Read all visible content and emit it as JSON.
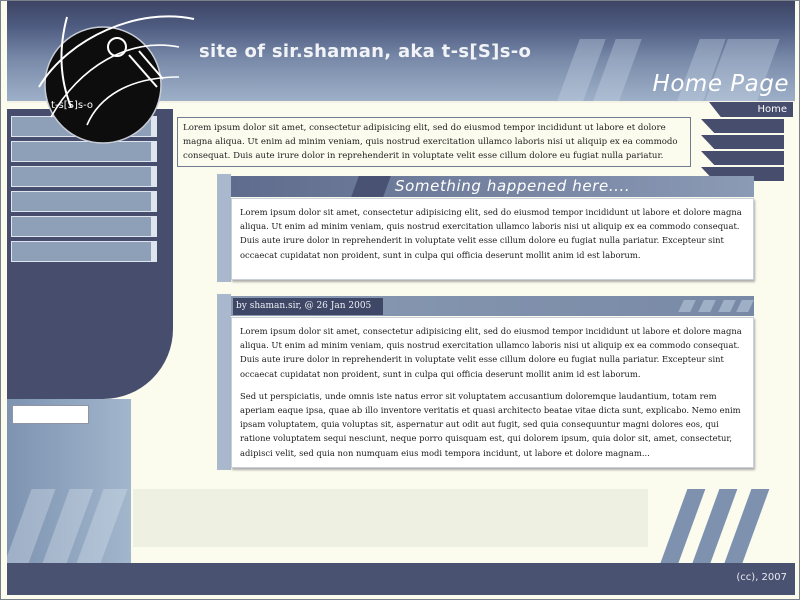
{
  "header": {
    "site_title": "site of sir.shaman, aka t-s[S]s-o",
    "page_heading": "Home Page",
    "logo_text": "t-s[S]s-o"
  },
  "nav": {
    "home_tab": "Home",
    "sidebar_buttons": [
      "",
      "",
      "",
      "",
      "",
      ""
    ],
    "side_tabs": [
      "",
      "",
      "",
      ""
    ]
  },
  "search": {
    "value": ""
  },
  "intro": {
    "text": "Lorem ipsum dolor sit amet, consectetur adipisicing elit, sed do eiusmod tempor incididunt ut labore et dolore magna aliqua. Ut enim ad minim veniam, quis nostrud exercitation ullamco laboris nisi ut aliquip ex ea commodo consequat. Duis aute irure dolor in reprehenderit in voluptate velit esse cillum dolore eu fugiat nulla pariatur."
  },
  "post1": {
    "title": "Something happened here....",
    "body": "Lorem ipsum dolor sit amet, consectetur adipisicing elit, sed do eiusmod tempor incididunt ut labore et dolore magna aliqua. Ut enim ad minim veniam, quis nostrud exercitation ullamco laboris nisi ut aliquip ex ea commodo consequat. Duis aute irure dolor in reprehenderit in voluptate velit esse cillum dolore eu fugiat nulla pariatur. Excepteur sint occaecat cupidatat non proident, sunt in culpa qui officia deserunt mollit anim id est laborum."
  },
  "post2": {
    "byline": "by shaman.sir, @ 26 Jan 2005",
    "paragraph1": "Lorem ipsum dolor sit amet, consectetur adipisicing elit, sed do eiusmod tempor incididunt ut labore et dolore magna aliqua. Ut enim ad minim veniam, quis nostrud exercitation ullamco laboris nisi ut aliquip ex ea commodo consequat. Duis aute irure dolor in reprehenderit in voluptate velit esse cillum dolore eu fugiat nulla pariatur. Excepteur sint occaecat cupidatat non proident, sunt in culpa qui officia deserunt mollit anim id est laborum.",
    "paragraph2": "Sed ut perspiciatis, unde omnis iste natus error sit voluptatem accusantium doloremque laudantium, totam rem aperiam eaque ipsa, quae ab illo inventore veritatis et quasi architecto beatae vitae dicta sunt, explicabo. Nemo enim ipsam voluptatem, quia voluptas sit, aspernatur aut odit aut fugit, sed quia consequuntur magni dolores eos, qui ratione voluptatem sequi nesciunt, neque porro quisquam est, qui dolorem ipsum, quia dolor sit, amet, consectetur, adipisci velit, sed quia non numquam eius modi tempora incidunt, ut labore et dolore magnam..."
  },
  "footer": {
    "text": "(cc), 2007"
  },
  "colors": {
    "accent_dark": "#474d6d",
    "accent_light": "#8ea0b8",
    "background": "#fbfbee"
  }
}
